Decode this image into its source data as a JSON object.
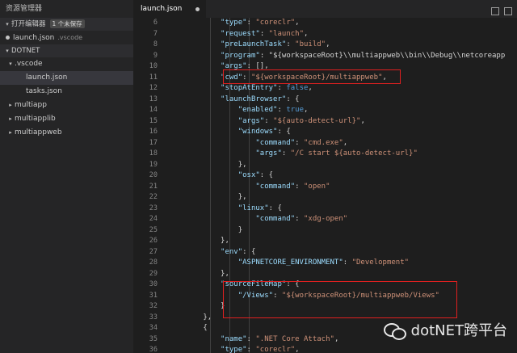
{
  "sidebar": {
    "title": "资源管理器",
    "open_editors_label": "打开编辑器",
    "unsaved_badge": "1 个未保存",
    "open_file": {
      "name": "launch.json",
      "path": ".vscode"
    },
    "folder_label": "DOTNET",
    "tree": [
      {
        "label": ".vscode",
        "caret": "▾"
      },
      {
        "label": "launch.json"
      },
      {
        "label": "tasks.json"
      },
      {
        "label": "multiapp",
        "caret": "▸"
      },
      {
        "label": "multiapplib",
        "caret": "▸"
      },
      {
        "label": "multiappweb",
        "caret": "▸"
      }
    ]
  },
  "editor": {
    "tab_label": "launch.json",
    "lines": [
      {
        "n": "6",
        "t": "            \"type\": \"coreclr\","
      },
      {
        "n": "7",
        "t": "            \"request\": \"launch\","
      },
      {
        "n": "8",
        "t": "            \"preLaunchTask\": \"build\","
      },
      {
        "n": "9",
        "t": "            \"program\": \"${workspaceRoot}\\\\multiappweb\\\\bin\\\\Debug\\\\netcoreapp"
      },
      {
        "n": "10",
        "t": "            \"args\": [],"
      },
      {
        "n": "11",
        "t": "            \"cwd\": \"${workspaceRoot}/multiappweb\","
      },
      {
        "n": "12",
        "t": "            \"stopAtEntry\": false,"
      },
      {
        "n": "13",
        "t": "            \"launchBrowser\": {"
      },
      {
        "n": "14",
        "t": "                \"enabled\": true,"
      },
      {
        "n": "15",
        "t": "                \"args\": \"${auto-detect-url}\","
      },
      {
        "n": "16",
        "t": "                \"windows\": {"
      },
      {
        "n": "17",
        "t": "                    \"command\": \"cmd.exe\","
      },
      {
        "n": "18",
        "t": "                    \"args\": \"/C start ${auto-detect-url}\""
      },
      {
        "n": "19",
        "t": "                },"
      },
      {
        "n": "20",
        "t": "                \"osx\": {"
      },
      {
        "n": "21",
        "t": "                    \"command\": \"open\""
      },
      {
        "n": "22",
        "t": "                },"
      },
      {
        "n": "23",
        "t": "                \"linux\": {"
      },
      {
        "n": "24",
        "t": "                    \"command\": \"xdg-open\""
      },
      {
        "n": "25",
        "t": "                }"
      },
      {
        "n": "26",
        "t": "            },"
      },
      {
        "n": "27",
        "t": "            \"env\": {"
      },
      {
        "n": "28",
        "t": "                \"ASPNETCORE_ENVIRONMENT\": \"Development\""
      },
      {
        "n": "29",
        "t": "            },"
      },
      {
        "n": "30",
        "t": "            \"sourceFileMap\": {"
      },
      {
        "n": "31",
        "t": "                \"/Views\": \"${workspaceRoot}/multiappweb/Views\""
      },
      {
        "n": "32",
        "t": "            }"
      },
      {
        "n": "33",
        "t": "        },"
      },
      {
        "n": "34",
        "t": "        {"
      },
      {
        "n": "35",
        "t": "            \"name\": \".NET Core Attach\","
      },
      {
        "n": "36",
        "t": "            \"type\": \"coreclr\","
      }
    ]
  },
  "watermark": "dotNET跨平台"
}
